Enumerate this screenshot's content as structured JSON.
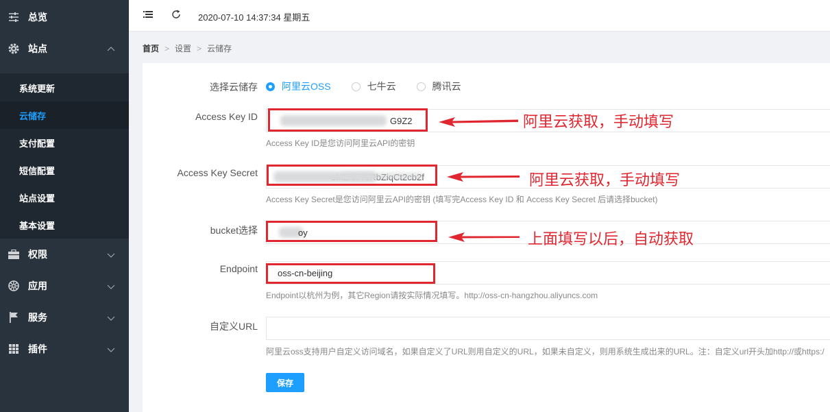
{
  "sidebar": {
    "overview": "总览",
    "site": "站点",
    "sub_items": [
      "系统更新",
      "云储存",
      "支付配置",
      "短信配置",
      "站点设置",
      "基本设置"
    ],
    "permissions": "权限",
    "apps": "应用",
    "services": "服务",
    "plugins": "插件"
  },
  "topbar": {
    "datetime": "2020-07-10 14:37:34 星期五"
  },
  "breadcrumb": {
    "home": "首页",
    "settings": "设置",
    "current": "云储存"
  },
  "form": {
    "storage_label": "选择云储存",
    "options": [
      "阿里云OSS",
      "七牛云",
      "腾讯云"
    ],
    "selected": "阿里云OSS",
    "access_key_id": {
      "label": "Access Key ID",
      "value": "G9Z2",
      "hint": "Access Key ID是您访问阿里云API的密钥"
    },
    "access_key_secret": {
      "label": "Access Key Secret",
      "value": "oMZN7ToRbZiqCt2cb2f",
      "hint": "Access Key Secret是您访问阿里云API的密钥 (填写完Access Key ID 和 Access Key Secret 后请选择bucket)"
    },
    "bucket": {
      "label": "bucket选择",
      "value": "oy"
    },
    "endpoint": {
      "label": "Endpoint",
      "value": "oss-cn-beijing",
      "hint": "Endpoint以杭州为例，其它Region请按实际情况填写。http://oss-cn-hangzhou.aliyuncs.com"
    },
    "custom_url": {
      "label": "自定义URL",
      "value": "",
      "hint": "阿里云oss支持用户自定义访问域名，如果自定义了URL则用自定义的URL，如果未自定义，则用系统生成出来的URL。注：自定义url开头加http://或https:/"
    },
    "save_label": "保存"
  },
  "annotations": {
    "key_id": "阿里云获取，手动填写",
    "key_secret": "阿里云获取，手动填写",
    "bucket": "上面填写以后，自动获取"
  },
  "colors": {
    "sidebar_bg": "#28333e",
    "accent": "#1e9fff",
    "annotation_red": "#e0262f"
  }
}
